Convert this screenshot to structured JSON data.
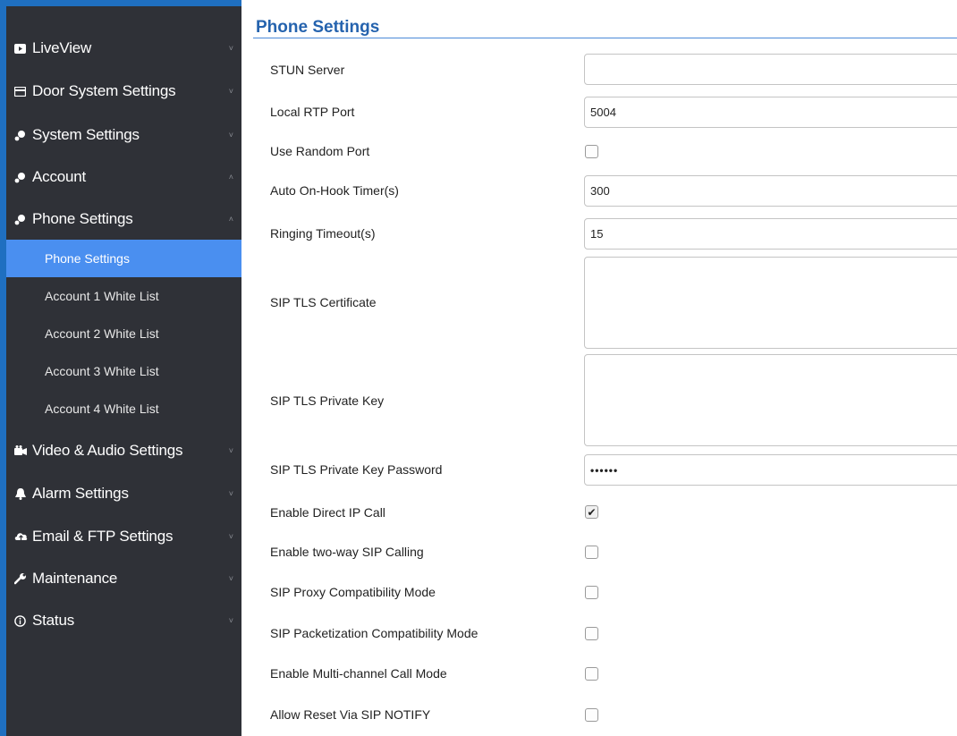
{
  "sidebar": {
    "items": [
      {
        "label": "LiveView",
        "icon": "play-icon",
        "chevron": "˅"
      },
      {
        "label": "Door System Settings",
        "icon": "card-icon",
        "chevron": "˅"
      },
      {
        "label": "System Settings",
        "icon": "gear-icon",
        "chevron": "˅"
      },
      {
        "label": "Account",
        "icon": "gear-icon",
        "chevron": "˄"
      },
      {
        "label": "Phone Settings",
        "icon": "gear-icon",
        "chevron": "˄"
      },
      {
        "label": "Video & Audio Settings",
        "icon": "video-icon",
        "chevron": "˅"
      },
      {
        "label": "Alarm Settings",
        "icon": "bell-icon",
        "chevron": "˅"
      },
      {
        "label": "Email & FTP Settings",
        "icon": "cloud-icon",
        "chevron": "˅"
      },
      {
        "label": "Maintenance",
        "icon": "wrench-icon",
        "chevron": "˅"
      },
      {
        "label": "Status",
        "icon": "info-icon",
        "chevron": "˅"
      }
    ],
    "subitems": [
      {
        "label": "Phone Settings"
      },
      {
        "label": "Account 1 White List"
      },
      {
        "label": "Account 2 White List"
      },
      {
        "label": "Account 3 White List"
      },
      {
        "label": "Account 4 White List"
      }
    ]
  },
  "main": {
    "title": "Phone Settings",
    "fields": {
      "stun_server": {
        "label": "STUN Server",
        "value": ""
      },
      "local_rtp_port": {
        "label": "Local RTP Port",
        "value": "5004"
      },
      "use_random_port": {
        "label": "Use Random Port",
        "checked": false
      },
      "auto_on_hook": {
        "label": "Auto On-Hook Timer(s)",
        "value": "300"
      },
      "ringing_timeout": {
        "label": "Ringing Timeout(s)",
        "value": "15"
      },
      "sip_tls_cert": {
        "label": "SIP TLS Certificate",
        "value": ""
      },
      "sip_tls_key": {
        "label": "SIP TLS Private Key",
        "value": ""
      },
      "sip_tls_key_pwd": {
        "label": "SIP TLS Private Key Password",
        "value": "••••••"
      },
      "direct_ip_call": {
        "label": "Enable Direct IP Call",
        "checked": true
      },
      "two_way_sip": {
        "label": "Enable two-way SIP Calling",
        "checked": false
      },
      "proxy_compat": {
        "label": "SIP Proxy Compatibility Mode",
        "checked": false
      },
      "packetization_compat": {
        "label": "SIP Packetization Compatibility Mode",
        "checked": false
      },
      "multichannel": {
        "label": "Enable Multi-channel Call Mode",
        "checked": false
      },
      "reset_via_notify": {
        "label": "Allow Reset Via SIP NOTIFY",
        "checked": false
      }
    }
  },
  "colors": {
    "sidebar_bg": "#2f3137",
    "accent": "#1f6fc0",
    "active_item": "#4a8ff0",
    "title": "#2563ae"
  }
}
